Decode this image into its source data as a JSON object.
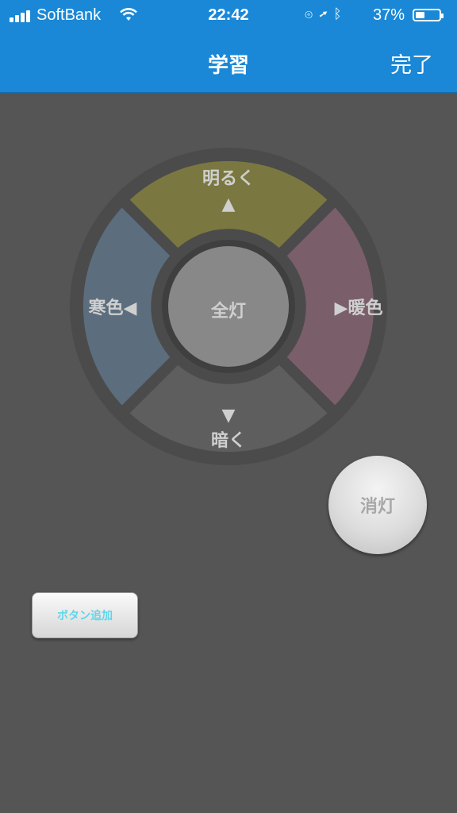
{
  "status_bar": {
    "carrier": "SoftBank",
    "time": "22:42",
    "battery_percent": "37%",
    "battery_level": 0.37,
    "icons": [
      "signal-icon",
      "wifi-icon",
      "orientation-lock-icon",
      "location-arrow-icon",
      "bluetooth-icon",
      "battery-icon"
    ]
  },
  "nav": {
    "title": "学習",
    "done_label": "完了",
    "bar_color": "#1a88d6"
  },
  "pad": {
    "top_label": "明るく",
    "top_arrow": "▲",
    "bottom_label": "暗く",
    "bottom_arrow": "▼",
    "left_label": "寒色◀",
    "right_label": "▶暖色",
    "center_label": "全灯",
    "colors": {
      "top": "#7a7840",
      "left": "#5c6d7e",
      "right": "#7a5e6a",
      "bottom": "#5e5e5e",
      "center": "#888888"
    }
  },
  "off_button_label": "消灯",
  "add_button_label": "ボタン追加"
}
